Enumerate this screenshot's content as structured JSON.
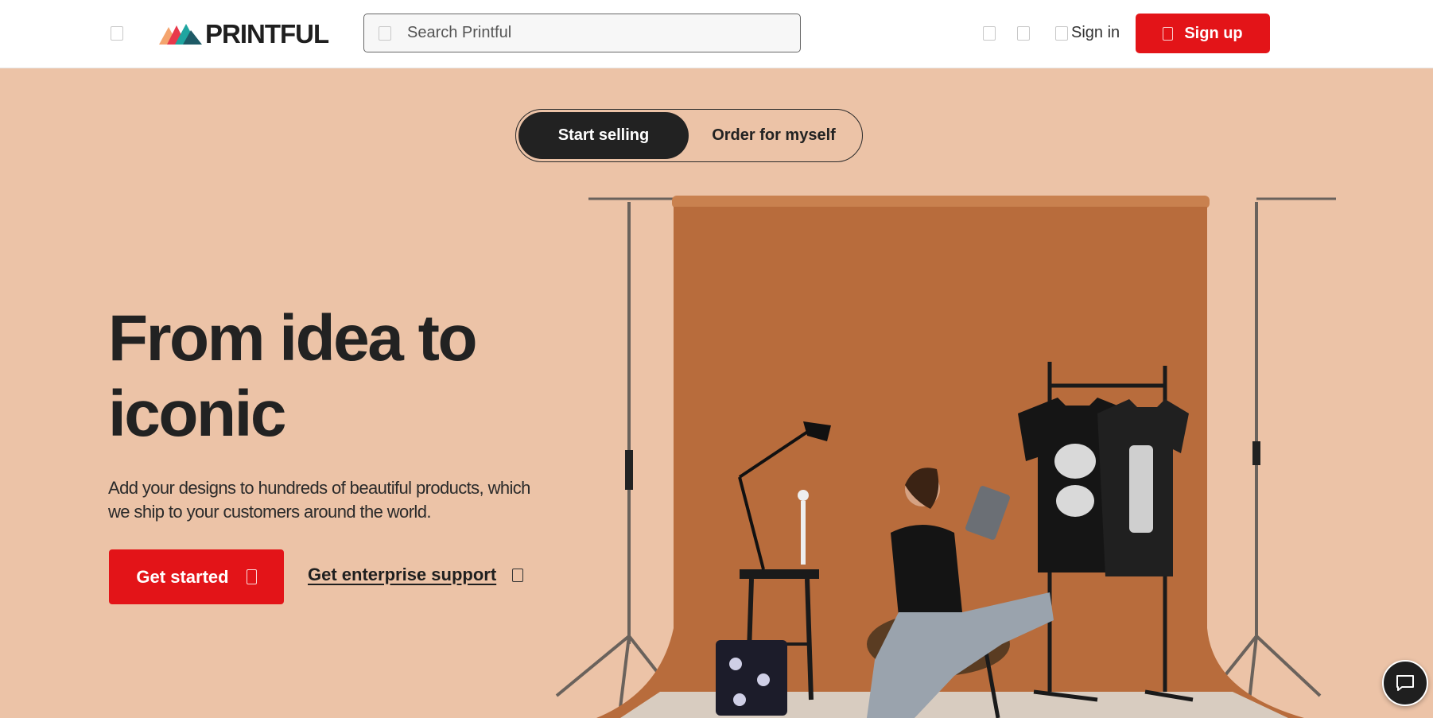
{
  "header": {
    "menu_icon": "hamburger-icon",
    "logo_text": "PRINTFUL",
    "search": {
      "placeholder": "Search Printful",
      "icon": "search-icon"
    },
    "icons": [
      "heart-icon",
      "cart-icon"
    ],
    "sign_in_label": "Sign in",
    "sign_up_label": "Sign up",
    "colors": {
      "accent": "#e31418"
    }
  },
  "toggle": {
    "active_label": "Start selling",
    "inactive_label": "Order for myself"
  },
  "hero": {
    "title": "From idea to iconic",
    "subtitle": "Add your designs to hundreds of beautiful products, which we ship to your customers around the world.",
    "primary_cta": "Get started",
    "secondary_cta": "Get enterprise support",
    "background_color": "#ecc3a7",
    "backdrop_color": "#b86c3c"
  },
  "chat": {
    "icon": "chat-bubble-icon"
  }
}
